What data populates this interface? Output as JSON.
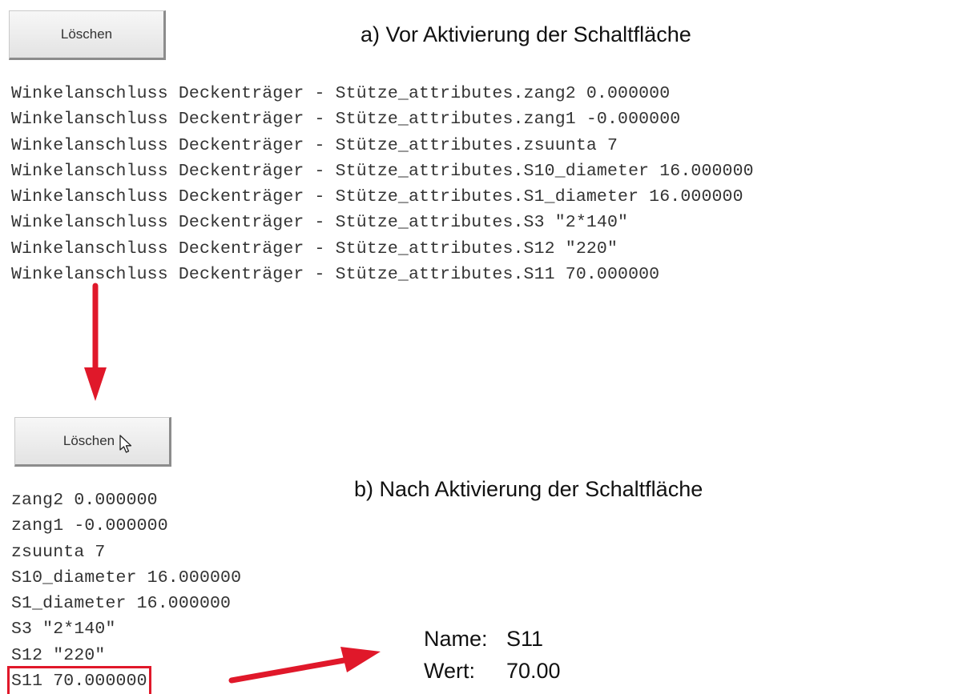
{
  "section_a": {
    "button_label": "Löschen",
    "heading": "a) Vor Aktivierung der Schaltfläche",
    "lines": [
      "Winkelanschluss Deckenträger - Stütze_attributes.zang2 0.000000",
      "Winkelanschluss Deckenträger - Stütze_attributes.zang1 -0.000000",
      "Winkelanschluss Deckenträger - Stütze_attributes.zsuunta 7",
      "Winkelanschluss Deckenträger - Stütze_attributes.S10_diameter 16.000000",
      "Winkelanschluss Deckenträger - Stütze_attributes.S1_diameter 16.000000",
      "Winkelanschluss Deckenträger - Stütze_attributes.S3 \"2*140\"",
      "Winkelanschluss Deckenträger - Stütze_attributes.S12 \"220\"",
      "Winkelanschluss Deckenträger - Stütze_attributes.S11 70.000000"
    ]
  },
  "section_b": {
    "button_label": "Löschen",
    "heading": "b) Nach Aktivierung der Schaltfläche",
    "lines": [
      "zang2 0.000000",
      "zang1 -0.000000",
      "zsuunta 7",
      "S10_diameter 16.000000",
      "S1_diameter 16.000000",
      "S3 \"2*140\"",
      "S12 \"220\"",
      "S11 70.000000"
    ]
  },
  "result": {
    "name_label": "Name:",
    "name_value": "S11",
    "value_label": "Wert:",
    "value_value": "70.00"
  },
  "colors": {
    "arrow": "#e0182a",
    "highlight": "#e0182a"
  },
  "icons": {
    "cursor": "mouse-pointer-icon",
    "arrow_down": "arrow-down-icon",
    "arrow_right": "arrow-right-icon"
  }
}
